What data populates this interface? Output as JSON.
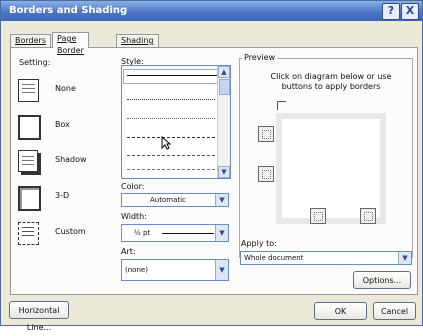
{
  "window": {
    "title": "Borders and Shading",
    "help_glyph": "?",
    "close_glyph": "X"
  },
  "tabs": [
    {
      "label": "Borders",
      "active": false
    },
    {
      "label": "Page Border",
      "active": true
    },
    {
      "label": "Shading",
      "active": false
    }
  ],
  "setting": {
    "label": "Setting:",
    "options": [
      {
        "label": "None",
        "icon": "setting-none-icon"
      },
      {
        "label": "Box",
        "icon": "setting-box-icon"
      },
      {
        "label": "Shadow",
        "icon": "setting-shadow-icon"
      },
      {
        "label": "3-D",
        "icon": "setting-3d-icon"
      },
      {
        "label": "Custom",
        "icon": "setting-custom-icon"
      }
    ]
  },
  "style": {
    "label": "Style:"
  },
  "color": {
    "label": "Color:",
    "value": "Automatic"
  },
  "width": {
    "label": "Width:",
    "value": "½ pt"
  },
  "art": {
    "label": "Art:",
    "value": "(none)"
  },
  "preview": {
    "label": "Preview",
    "instructions": "Click on diagram below or use buttons to apply borders"
  },
  "apply_to": {
    "label": "Apply to:",
    "value": "Whole document"
  },
  "buttons": {
    "options": "Options...",
    "horizontal_line": "Horizontal Line...",
    "ok": "OK",
    "cancel": "Cancel"
  }
}
